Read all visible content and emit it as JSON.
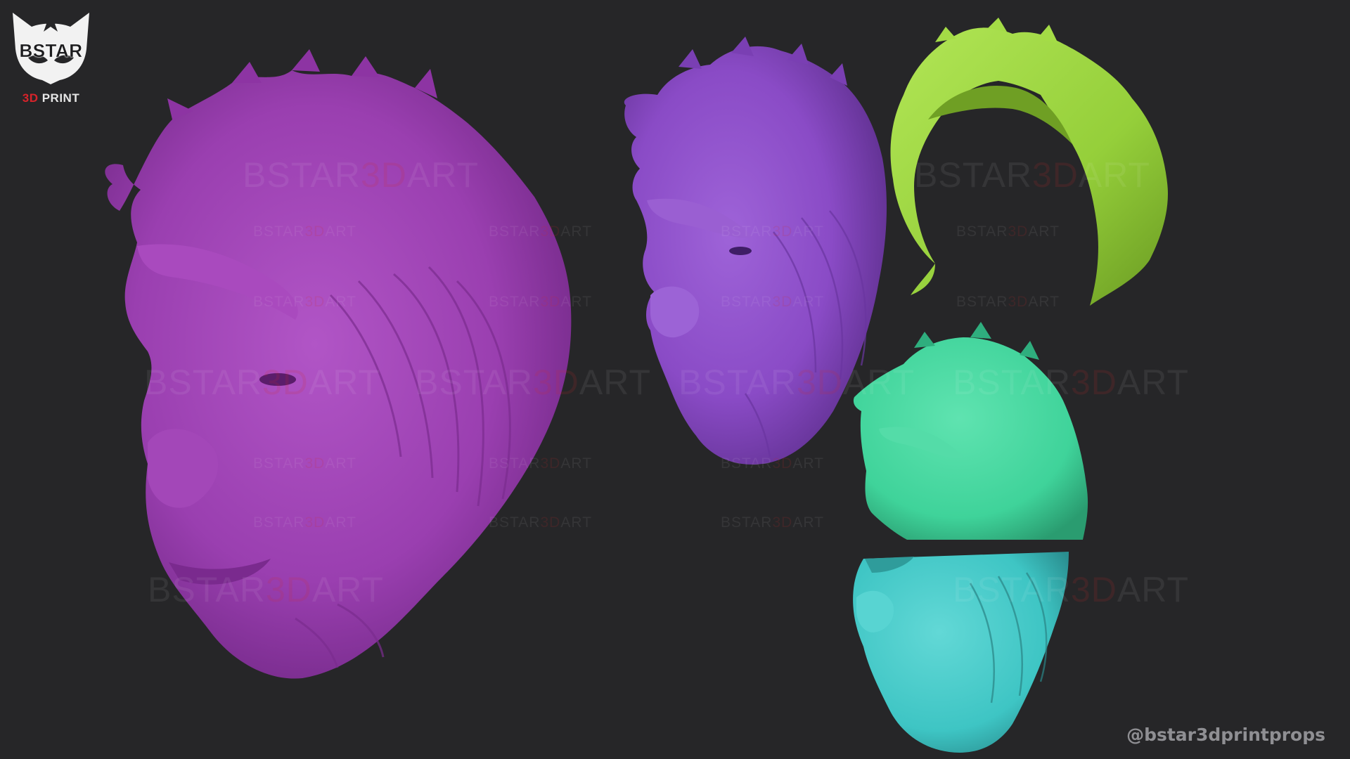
{
  "logo": {
    "name": "BSTAR",
    "tagline_accent": "3D",
    "tagline_rest": " PRINT"
  },
  "watermark": {
    "part1": "BSTAR",
    "part2": "3D",
    "part3": "ART"
  },
  "credit": "@bstar3dprintprops",
  "colors": {
    "background": "#262628",
    "full_head_large": "#9a3fb0",
    "full_head_small": "#8a4bc6",
    "hair_cap": "#98d13a",
    "upper_face": "#3fd39a",
    "lower_face": "#3ec5c4",
    "brand_red": "#d8232a"
  }
}
